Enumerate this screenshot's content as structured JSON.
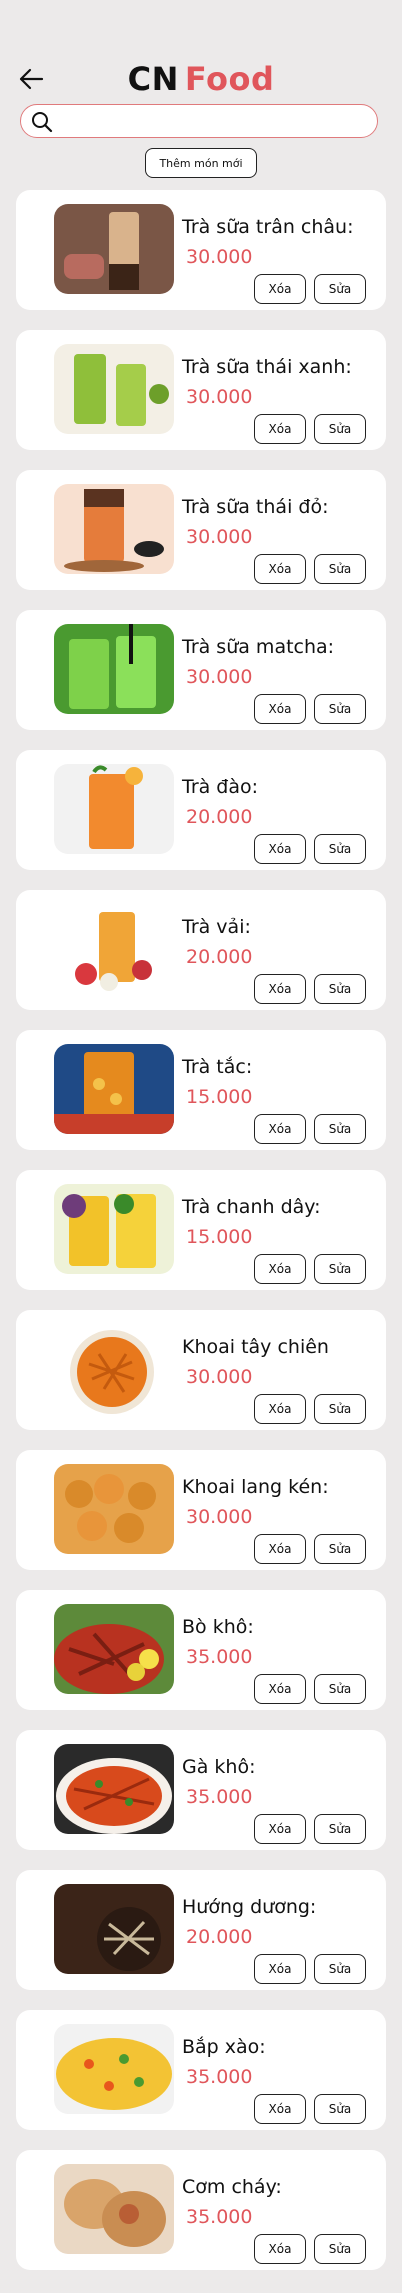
{
  "header": {
    "title_part1": "CN",
    "title_part2": "Food",
    "back_icon": "arrow-left-icon"
  },
  "search": {
    "placeholder": "",
    "value": "",
    "icon": "search-icon"
  },
  "add_button_label": "Thêm món mới",
  "colors": {
    "accent": "#e0565b",
    "background": "#eceaea",
    "card": "#ffffff"
  },
  "buttons": {
    "delete": "Xóa",
    "edit": "Sửa"
  },
  "items": [
    {
      "name": "Trà sữa trân châu:",
      "price": "30.000",
      "image": "bubble-milk-tea"
    },
    {
      "name": "Trà sữa thái xanh:",
      "price": "30.000",
      "image": "thai-green-milk-tea"
    },
    {
      "name": "Trà sữa thái đỏ:",
      "price": "30.000",
      "image": "thai-red-milk-tea"
    },
    {
      "name": "Trà sữa matcha:",
      "price": "30.000",
      "image": "matcha-milk-tea"
    },
    {
      "name": "Trà đào:",
      "price": "20.000",
      "image": "peach-tea"
    },
    {
      "name": "Trà vải:",
      "price": "20.000",
      "image": "lychee-tea"
    },
    {
      "name": "Trà tắc:",
      "price": "15.000",
      "image": "kumquat-tea"
    },
    {
      "name": "Trà chanh dây:",
      "price": "15.000",
      "image": "passion-fruit-tea"
    },
    {
      "name": "Khoai tây chiên",
      "price": "30.000",
      "image": "french-fries"
    },
    {
      "name": "Khoai lang kén:",
      "price": "30.000",
      "image": "sweet-potato-balls"
    },
    {
      "name": "Bò khô:",
      "price": "35.000",
      "image": "beef-jerky"
    },
    {
      "name": "Gà khô:",
      "price": "35.000",
      "image": "chicken-jerky"
    },
    {
      "name": "Hướng dương:",
      "price": "20.000",
      "image": "sunflower-seeds"
    },
    {
      "name": "Bắp xào:",
      "price": "35.000",
      "image": "stir-fried-corn"
    },
    {
      "name": "Cơm cháy:",
      "price": "35.000",
      "image": "crispy-rice"
    }
  ]
}
